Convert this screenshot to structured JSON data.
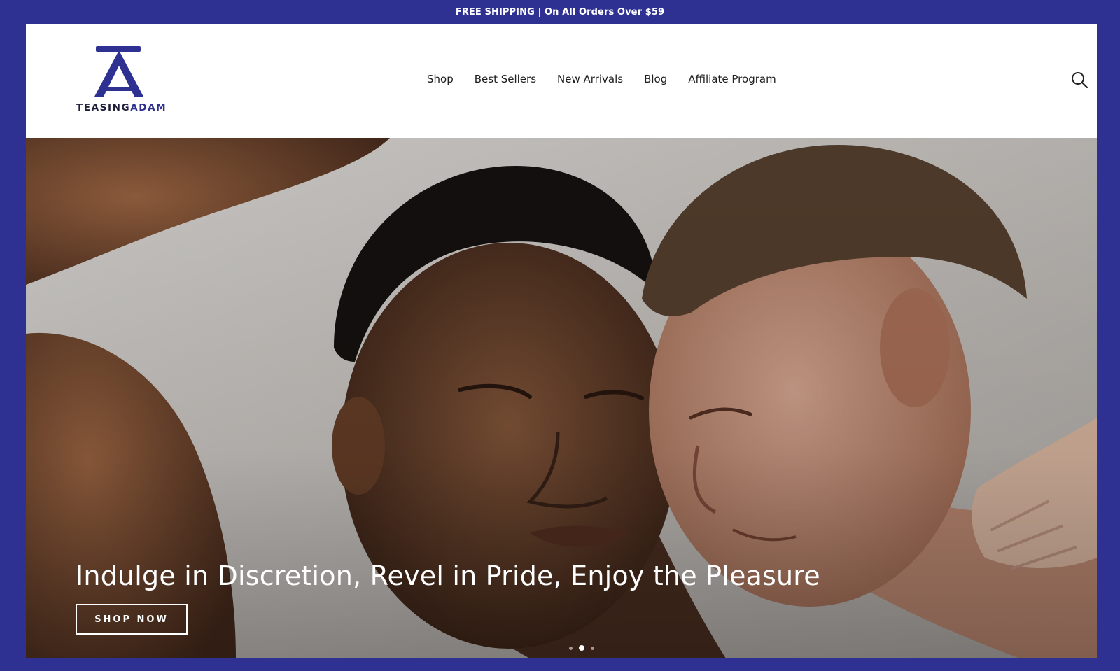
{
  "announcement": "FREE SHIPPING | On All Orders Over $59",
  "brand": {
    "word_dark": "TEASING",
    "word_accent": "ADAM",
    "logo_icon": "spade-a-monogram"
  },
  "nav": {
    "items": [
      {
        "label": "Shop"
      },
      {
        "label": "Best Sellers"
      },
      {
        "label": "New Arrivals"
      },
      {
        "label": "Blog"
      },
      {
        "label": "Affiliate Program"
      }
    ],
    "search_icon": "search-icon"
  },
  "hero": {
    "heading": "Indulge in Discretion, Revel in Pride, Enjoy the Pleasure",
    "cta_label": "SHOP NOW",
    "slides_total": 3,
    "active_slide": 2
  },
  "colors": {
    "brand_primary": "#2e3192",
    "text_dark": "#1d1d1d",
    "white": "#ffffff"
  }
}
